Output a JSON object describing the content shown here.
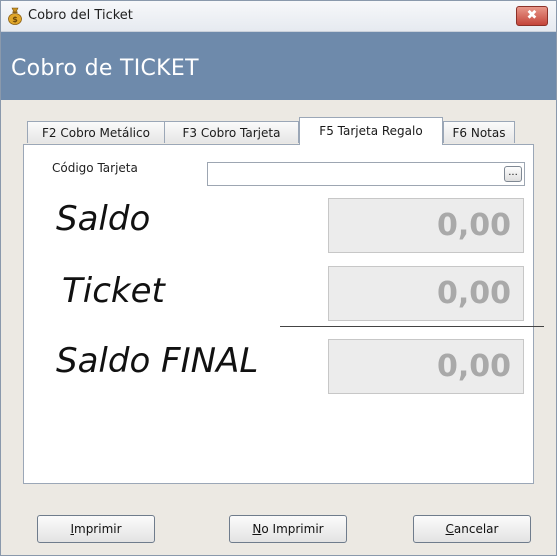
{
  "window": {
    "title": "Cobro del Ticket",
    "close_glyph": "✖",
    "app_icon": "money-bag-icon"
  },
  "header": {
    "title": "Cobro de TICKET"
  },
  "tabs": [
    {
      "label": "F2 Cobro Metálico",
      "active": false
    },
    {
      "label": "F3 Cobro Tarjeta",
      "active": false
    },
    {
      "label": "F5 Tarjeta Regalo",
      "active": true
    },
    {
      "label": "F6 Notas",
      "active": false
    }
  ],
  "gift_card": {
    "code_label": "Código Tarjeta",
    "code_value": "",
    "browse_label": "...",
    "saldo_label": "Saldo",
    "saldo_value": "0,00",
    "ticket_label": "Ticket",
    "ticket_value": "0,00",
    "final_label": "Saldo FINAL",
    "final_value": "0,00"
  },
  "buttons": {
    "print": {
      "mnemonic": "I",
      "rest": "mprimir"
    },
    "no_print": {
      "mnemonic": "N",
      "rest": "o Imprimir"
    },
    "cancel": {
      "mnemonic": "C",
      "rest": "ancelar"
    }
  },
  "colors": {
    "header_band": "#6e8aab",
    "amount_text": "#a9a9a9"
  }
}
